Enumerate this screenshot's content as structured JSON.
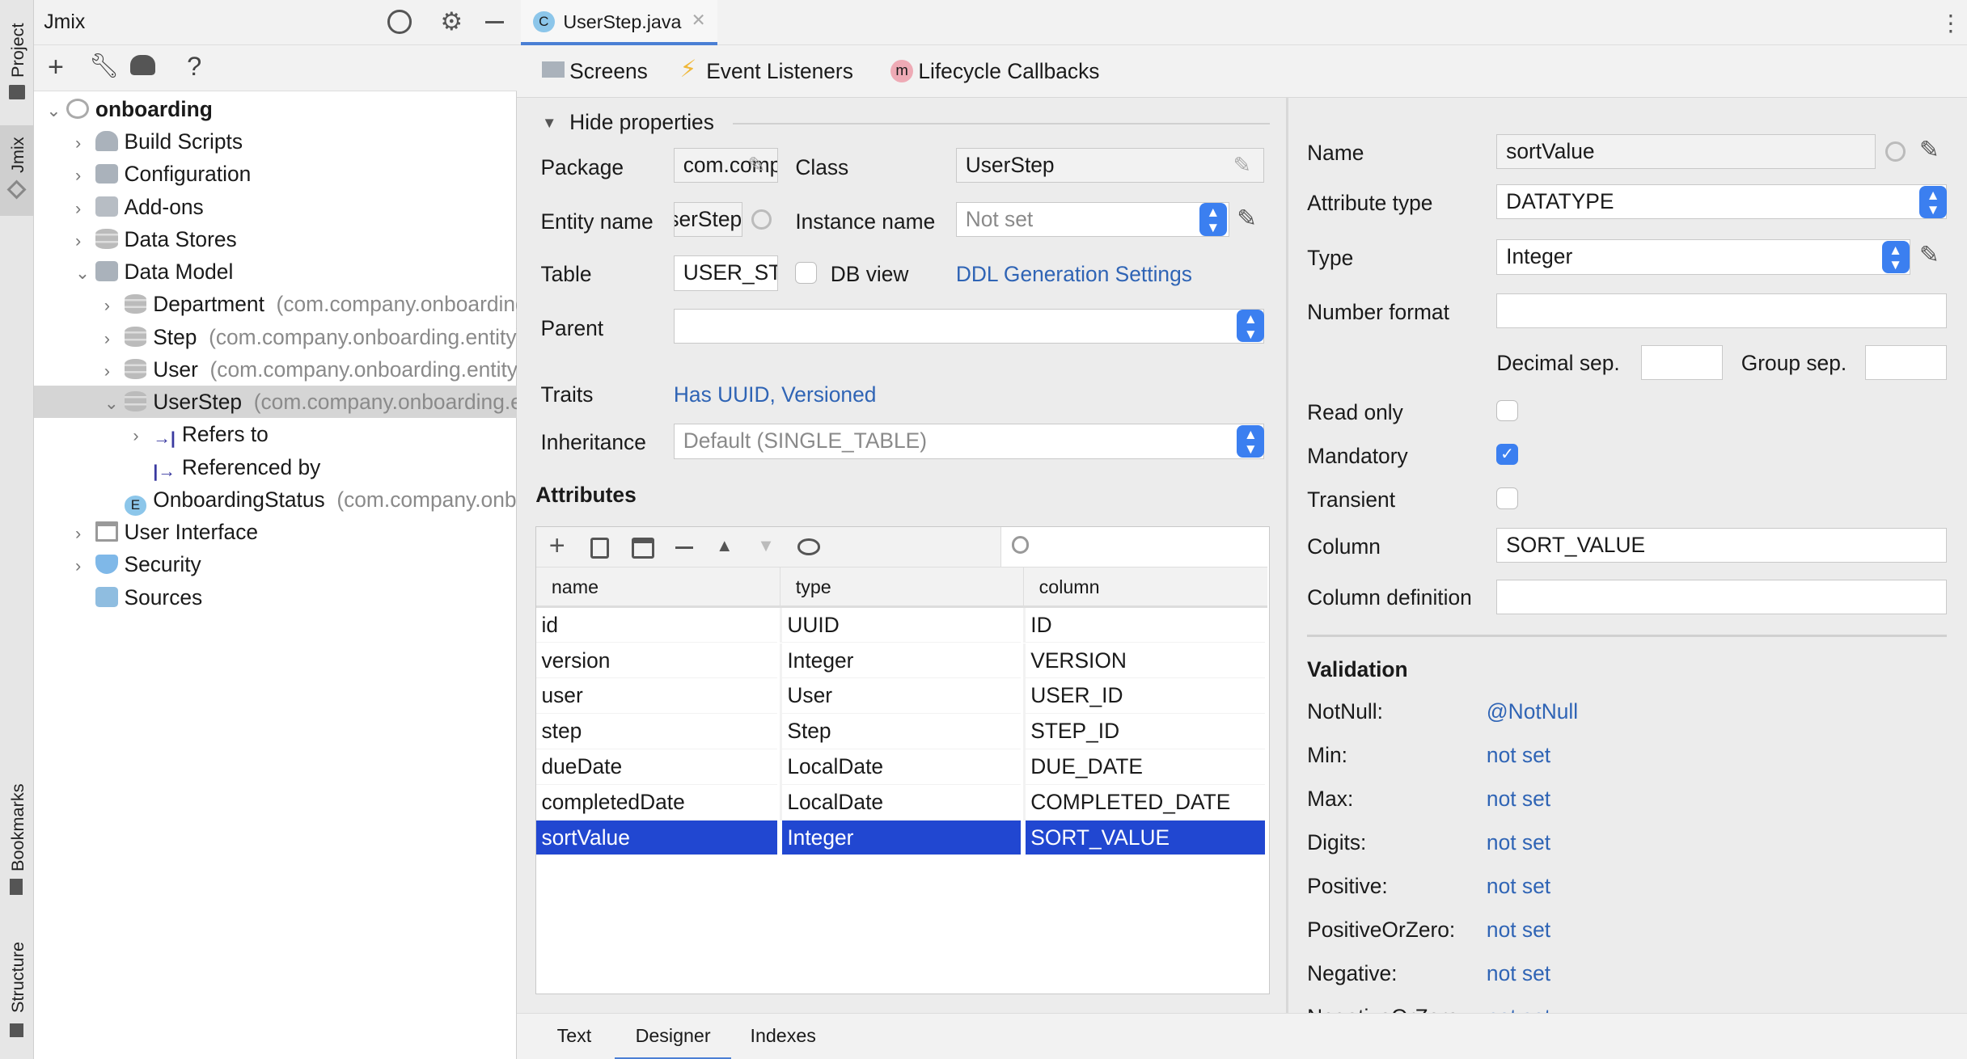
{
  "sidestrip": {
    "project": "Project",
    "jmix": "Jmix",
    "bookmarks": "Bookmarks",
    "structure": "Structure"
  },
  "project_panel": {
    "title": "Jmix",
    "tree": [
      {
        "label": "onboarding",
        "icon": "jmix-project-icon",
        "expanded": true
      },
      {
        "label": "Build Scripts",
        "icon": "gradle-icon"
      },
      {
        "label": "Configuration",
        "icon": "config-icon"
      },
      {
        "label": "Add-ons",
        "icon": "puzzle-icon"
      },
      {
        "label": "Data Stores",
        "icon": "database-icon"
      },
      {
        "label": "Data Model",
        "icon": "data-model-icon",
        "expanded": true
      },
      {
        "label": "Department",
        "pkg": "(com.company.onboarding.entity)",
        "icon": "entity-icon"
      },
      {
        "label": "Step",
        "pkg": "(com.company.onboarding.entity)",
        "icon": "entity-icon"
      },
      {
        "label": "User",
        "pkg": "(com.company.onboarding.entity)",
        "icon": "entity-icon"
      },
      {
        "label": "UserStep",
        "pkg": "(com.company.onboarding.entity)",
        "icon": "entity-icon",
        "selected": true
      },
      {
        "label": "Refers to",
        "icon": "arrow-right-bar-icon"
      },
      {
        "label": "Referenced by",
        "icon": "bar-arrow-right-icon"
      },
      {
        "label": "OnboardingStatus",
        "pkg": "(com.company.onboarding.entity)",
        "icon": "enum-icon"
      },
      {
        "label": "User Interface",
        "icon": "window-icon"
      },
      {
        "label": "Security",
        "icon": "shield-icon"
      },
      {
        "label": "Sources",
        "icon": "folder-icon"
      }
    ]
  },
  "editor": {
    "tab": "UserStep.java",
    "tab_icon": "C",
    "designer_tabs": [
      "Screens",
      "Event Listeners",
      "Lifecycle Callbacks"
    ],
    "hide_properties": "Hide properties",
    "form": {
      "package_label": "Package",
      "package_value": "com.company.onboarding.entity",
      "class_label": "Class",
      "class_value": "UserStep",
      "entity_name_label": "Entity name",
      "entity_name_value": "UserStep",
      "instance_name_label": "Instance name",
      "instance_name_placeholder": "Not set",
      "table_label": "Table",
      "table_value": "USER_STEP",
      "db_view_label": "DB view",
      "ddl_link": "DDL Generation Settings",
      "parent_label": "Parent",
      "parent_value": "",
      "traits_label": "Traits",
      "traits_value": "Has UUID, Versioned",
      "inheritance_label": "Inheritance",
      "inheritance_value": "Default (SINGLE_TABLE)"
    },
    "attributes_title": "Attributes",
    "attributes": {
      "columns": [
        "name",
        "type",
        "column"
      ],
      "rows": [
        [
          "id",
          "UUID",
          "ID"
        ],
        [
          "version",
          "Integer",
          "VERSION"
        ],
        [
          "user",
          "User",
          "USER_ID"
        ],
        [
          "step",
          "Step",
          "STEP_ID"
        ],
        [
          "dueDate",
          "LocalDate",
          "DUE_DATE"
        ],
        [
          "completedDate",
          "LocalDate",
          "COMPLETED_DATE"
        ],
        [
          "sortValue",
          "Integer",
          "SORT_VALUE"
        ]
      ],
      "selected_row": 6
    },
    "bottom_tabs": [
      "Text",
      "Designer",
      "Indexes"
    ],
    "active_bottom_tab": "Designer"
  },
  "properties": {
    "name_label": "Name",
    "name_value": "sortValue",
    "attr_type_label": "Attribute type",
    "attr_type_value": "DATATYPE",
    "type_label": "Type",
    "type_value": "Integer",
    "number_format_label": "Number format",
    "number_format_value": "",
    "decimal_sep_label": "Decimal sep.",
    "group_sep_label": "Group sep.",
    "read_only_label": "Read only",
    "read_only": false,
    "mandatory_label": "Mandatory",
    "mandatory": true,
    "transient_label": "Transient",
    "transient": false,
    "column_label": "Column",
    "column_value": "SORT_VALUE",
    "column_def_label": "Column definition",
    "column_def_value": "",
    "validation_title": "Validation",
    "validation": [
      {
        "label": "NotNull:",
        "value": "@NotNull"
      },
      {
        "label": "Min:",
        "value": "not set"
      },
      {
        "label": "Max:",
        "value": "not set"
      },
      {
        "label": "Digits:",
        "value": "not set"
      },
      {
        "label": "Positive:",
        "value": "not set"
      },
      {
        "label": "PositiveOrZero:",
        "value": "not set"
      },
      {
        "label": "Negative:",
        "value": "not set"
      },
      {
        "label": "NegativeOrZero:",
        "value": "not set"
      }
    ]
  },
  "colors": {
    "accent": "#3b7ff0",
    "selection": "#2147d1",
    "link": "#2f64b5"
  }
}
